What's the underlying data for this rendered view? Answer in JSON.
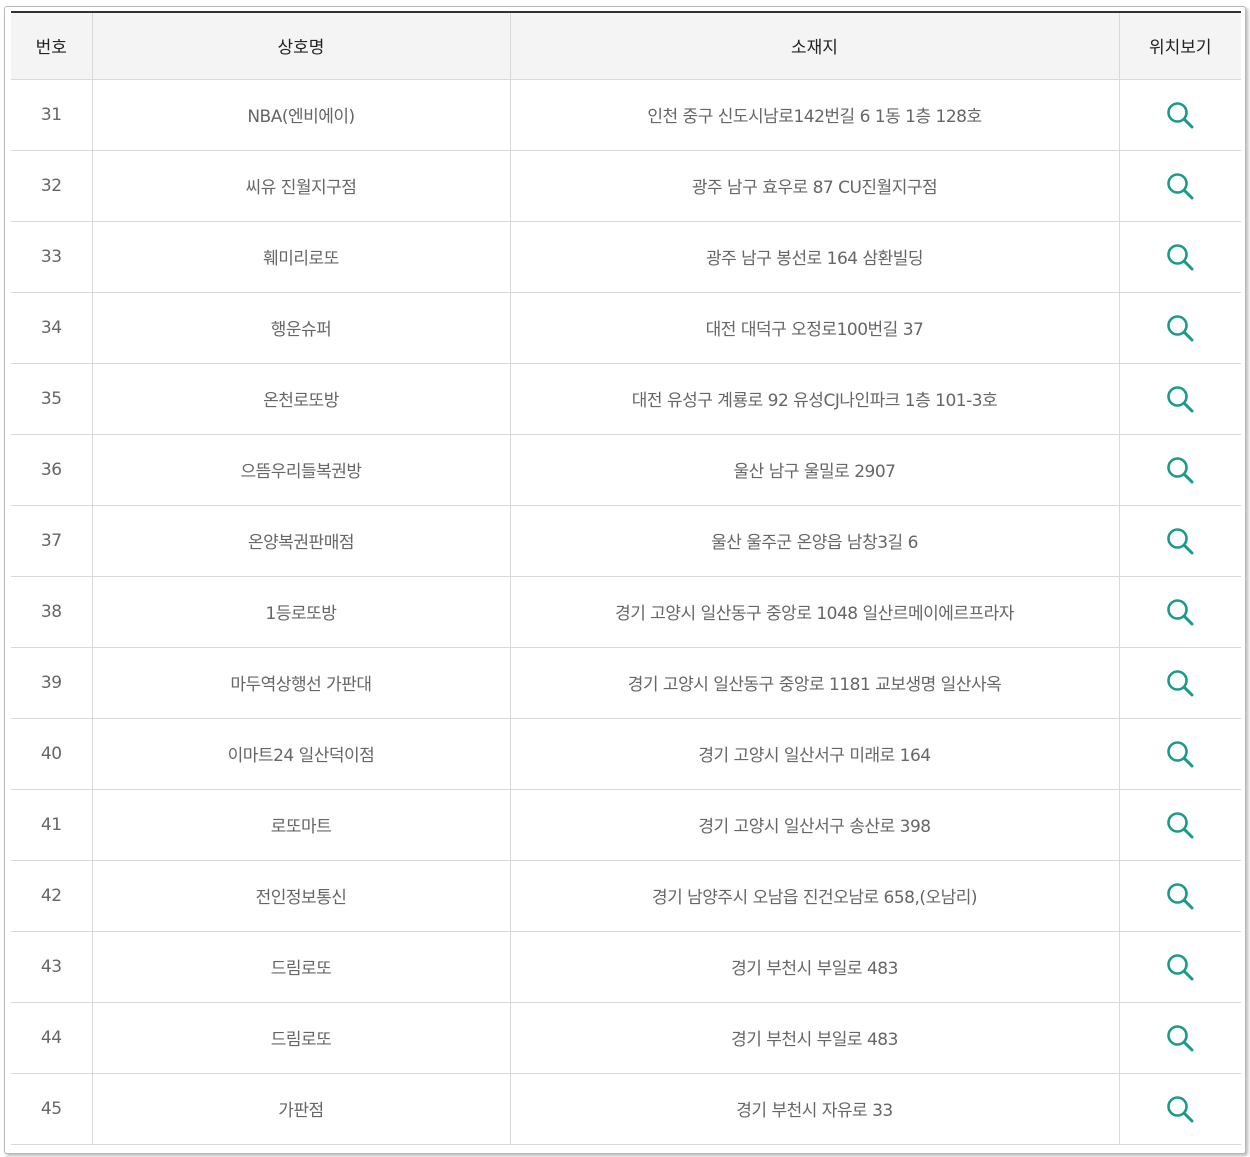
{
  "table": {
    "headers": {
      "number": "번호",
      "name": "상호명",
      "address": "소재지",
      "map": "위치보기"
    },
    "icon_color": "#1a9a8a",
    "rows": [
      {
        "number": "31",
        "name": "NBA(엔비에이)",
        "address": "인천 중구 신도시남로142번길 6 1동 1층 128호",
        "map_icon": "search-icon"
      },
      {
        "number": "32",
        "name": "씨유 진월지구점",
        "address": "광주 남구 효우로 87 CU진월지구점",
        "map_icon": "search-icon"
      },
      {
        "number": "33",
        "name": "훼미리로또",
        "address": "광주 남구 봉선로 164 삼환빌딩",
        "map_icon": "search-icon"
      },
      {
        "number": "34",
        "name": "행운슈퍼",
        "address": "대전 대덕구 오정로100번길 37",
        "map_icon": "search-icon"
      },
      {
        "number": "35",
        "name": "온천로또방",
        "address": "대전 유성구 계룡로 92 유성CJ나인파크 1층 101-3호",
        "map_icon": "search-icon"
      },
      {
        "number": "36",
        "name": "으뜸우리들복권방",
        "address": "울산 남구 울밀로 2907",
        "map_icon": "search-icon"
      },
      {
        "number": "37",
        "name": "온양복권판매점",
        "address": "울산 울주군 온양읍 남창3길 6",
        "map_icon": "search-icon"
      },
      {
        "number": "38",
        "name": "1등로또방",
        "address": "경기 고양시 일산동구 중앙로 1048 일산르메이에르프라자",
        "map_icon": "search-icon"
      },
      {
        "number": "39",
        "name": "마두역상행선 가판대",
        "address": "경기 고양시 일산동구 중앙로 1181 교보생명 일산사옥",
        "map_icon": "search-icon"
      },
      {
        "number": "40",
        "name": "이마트24 일산덕이점",
        "address": "경기 고양시 일산서구 미래로 164",
        "map_icon": "search-icon"
      },
      {
        "number": "41",
        "name": "로또마트",
        "address": "경기 고양시 일산서구 송산로 398",
        "map_icon": "search-icon"
      },
      {
        "number": "42",
        "name": "전인정보통신",
        "address": "경기 남양주시 오남읍 진건오남로 658,(오남리)",
        "map_icon": "search-icon"
      },
      {
        "number": "43",
        "name": "드림로또",
        "address": "경기 부천시 부일로 483",
        "map_icon": "search-icon"
      },
      {
        "number": "44",
        "name": "드림로또",
        "address": "경기 부천시 부일로 483",
        "map_icon": "search-icon"
      },
      {
        "number": "45",
        "name": "가판점",
        "address": "경기 부천시 자유로 33",
        "map_icon": "search-icon"
      }
    ]
  }
}
